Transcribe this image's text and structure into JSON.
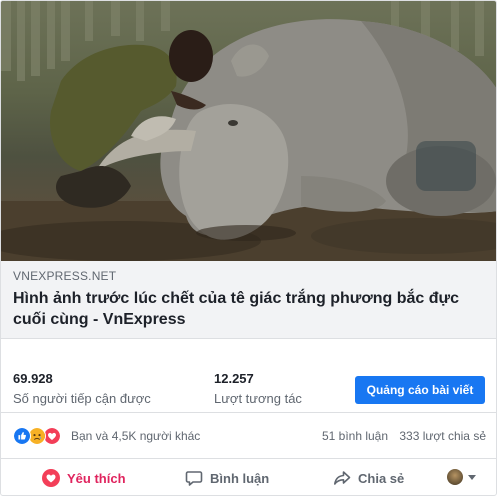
{
  "link_preview": {
    "domain": "VNEXPRESS.NET",
    "title": "Hình ảnh trước lúc chết của tê giác trắng phương bắc đực cuối cùng - VnExpress"
  },
  "stats": {
    "reach": {
      "value": "69.928",
      "label": "Số người tiếp cận được"
    },
    "engagement": {
      "value": "12.257",
      "label": "Lượt tương tác"
    },
    "boost_label": "Quảng cáo bài viết"
  },
  "reactions": {
    "icons": [
      "like-icon",
      "sad-icon",
      "love-icon"
    ],
    "summary": "Bạn và 4,5K người khác",
    "comments": "51 bình luận",
    "shares": "333 lượt chia sẻ"
  },
  "actions": {
    "like_label": "Yêu thích",
    "comment_label": "Bình luận",
    "share_label": "Chia sẻ"
  },
  "colors": {
    "accent": "#1877f2",
    "love": "#e0245e",
    "sad": "#f7b125"
  }
}
